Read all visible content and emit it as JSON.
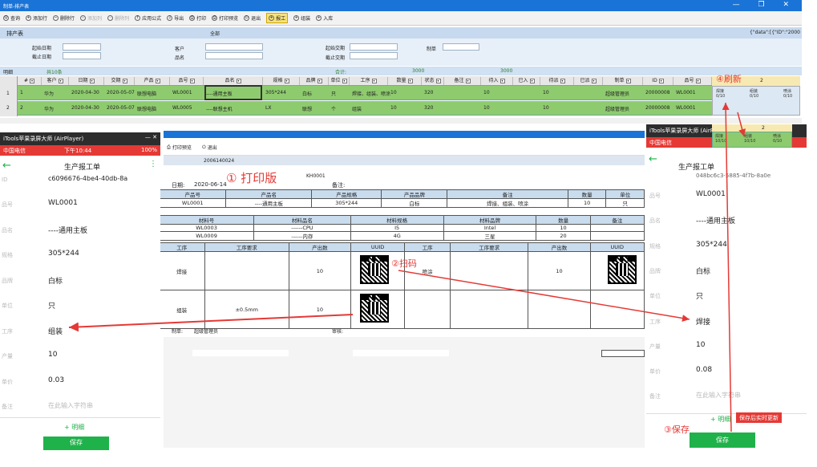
{
  "window": {
    "title": "制单-排产表",
    "controls": "—  ❐  ✕"
  },
  "toolbar": [
    {
      "icon": "search-icon",
      "glyph": "Q",
      "label": "查询",
      "enabled": true
    },
    {
      "icon": "add-row-icon",
      "glyph": "+",
      "label": "添加行",
      "enabled": true
    },
    {
      "icon": "delete-row-icon",
      "glyph": "−",
      "label": "删除行",
      "enabled": true
    },
    {
      "icon": "add-col-icon",
      "glyph": "+",
      "label": "添加列",
      "enabled": false
    },
    {
      "icon": "delete-col-icon",
      "glyph": "−",
      "label": "删除列",
      "enabled": false
    },
    {
      "icon": "formula-icon",
      "glyph": "f",
      "label": "应用公式",
      "enabled": true
    },
    {
      "icon": "export-icon",
      "glyph": "⇩",
      "label": "导出",
      "enabled": true
    },
    {
      "icon": "print-icon",
      "glyph": "⎙",
      "label": "打印",
      "enabled": true
    },
    {
      "icon": "print-preview-icon",
      "glyph": "⎙",
      "label": "打印预览",
      "enabled": true
    },
    {
      "icon": "exit-icon",
      "glyph": "⏻",
      "label": "退出",
      "enabled": true
    },
    {
      "icon": "report-icon",
      "glyph": "+",
      "label": "报工",
      "enabled": true,
      "highlight": true
    },
    {
      "icon": "assemble-icon",
      "glyph": "+",
      "label": "组装",
      "enabled": true
    },
    {
      "icon": "stock-in-icon",
      "glyph": "+",
      "label": "入库",
      "enabled": true
    }
  ],
  "section": {
    "title": "排产表",
    "scope": "全部",
    "right": "{\"data\":[{\"ID\":\"2000"
  },
  "form": {
    "start_date": "起始日期",
    "end_date": "截止日期",
    "customer": "客户",
    "product_name": "品名",
    "delivery_start": "起始交期",
    "delivery_end": "截止交期",
    "maker": "制单"
  },
  "summary": {
    "tab": "明细",
    "count": "共10条",
    "total": "合计:",
    "qty_sum": "3000",
    "qty_sum2": "3000"
  },
  "grid": {
    "columns": [
      "#",
      "客户",
      "日期",
      "交期",
      "产品",
      "品号",
      "品名",
      "规格",
      "品牌",
      "单位",
      "工序",
      "数量",
      "状态",
      "备注",
      "待入",
      "已入",
      "待派",
      "已派",
      "制单",
      "ID",
      "品号"
    ],
    "rows": [
      [
        "1",
        "华为",
        "2020-04-30",
        "2020-05-07",
        "联想电脑",
        "WL0001",
        "----通用主板",
        "305*244",
        "白标",
        "只",
        "焊接、组装、喷涂",
        "10",
        "320",
        "",
        "10",
        "",
        "10",
        "",
        "超级管理员",
        "20000008",
        "WL0001"
      ],
      [
        "2",
        "华为",
        "2020-04-30",
        "2020-05-07",
        "联想电脑",
        "WL0005",
        "----联想主机",
        "LX",
        "联想",
        "个",
        "组装",
        "10",
        "320",
        "",
        "10",
        "",
        "10",
        "",
        "超级管理员",
        "20000008",
        "WL0001"
      ]
    ],
    "right_header": "2",
    "right_cells": [
      [
        "焊接",
        "0/10"
      ],
      [
        "组装",
        "0/10"
      ],
      [
        "喷涂",
        "0/10"
      ]
    ]
  },
  "phone_left": {
    "title": "iTools苹果录屏大师 (AirPlayer)",
    "carrier": "中国电信",
    "time": "下午10:44",
    "battery": "100%",
    "header": "生产报工单",
    "id_label": "ID",
    "id_value": "c6096676-4be4-40db-8a",
    "fields": [
      {
        "label": "品号",
        "value": "WL0001"
      },
      {
        "label": "品名",
        "value": "----通用主板"
      },
      {
        "label": "规格",
        "value": "305*244"
      },
      {
        "label": "品牌",
        "value": "白标"
      },
      {
        "label": "单位",
        "value": "只"
      },
      {
        "label": "工序",
        "value": "组装"
      },
      {
        "label": "产量",
        "value": "10"
      },
      {
        "label": "单价",
        "value": "0.03"
      },
      {
        "label": "备注",
        "value": "在此输入字符串"
      }
    ],
    "detail_btn": "+ 明细",
    "save": "保存"
  },
  "phone_right": {
    "title": "iTools苹果录屏大师 (AirPlayer)",
    "carrier": "中国电信",
    "header": "生产报工单",
    "id_value": "048bc6c3-5885-4f7b-8a0e",
    "fields": [
      {
        "label": "品号",
        "value": "WL0001"
      },
      {
        "label": "品名",
        "value": "----通用主板"
      },
      {
        "label": "规格",
        "value": "305*244"
      },
      {
        "label": "品牌",
        "value": "白标"
      },
      {
        "label": "单位",
        "value": "只"
      },
      {
        "label": "工序",
        "value": "焊接"
      },
      {
        "label": "产量",
        "value": "10"
      },
      {
        "label": "单价",
        "value": "0.08"
      },
      {
        "label": "备注",
        "value": "在此输入字符串"
      }
    ],
    "detail_btn": "+ 明细",
    "save": "保存",
    "popup_header": "2",
    "popup_cells": [
      [
        "焊接",
        "10/10"
      ],
      [
        "组装",
        "10/10"
      ],
      [
        "喷涂",
        "0/10"
      ]
    ]
  },
  "print": {
    "toolbar": [
      {
        "icon": "print-icon",
        "label": "打印预览"
      },
      {
        "icon": "exit-icon",
        "label": "退出"
      }
    ],
    "doc_no": "2006140024",
    "kh": "KH0001",
    "date_label": "日期:",
    "date": "2020-06-14",
    "remark_label": "备注:",
    "product_head": [
      "产品号",
      "产品名",
      "产品规格",
      "产品品牌",
      "备注",
      "数量",
      "单位"
    ],
    "product_row": [
      "WL0001",
      "----通用主板",
      "305*244",
      "白标",
      "焊接、组装、喷涂",
      "10",
      "只"
    ],
    "mat_head": [
      "材料号",
      "材料品名",
      "材料规格",
      "材料品牌",
      "数量",
      "备注"
    ],
    "mat_rows": [
      [
        "WL0003",
        "------CPU",
        "I5",
        "Intel",
        "10",
        ""
      ],
      [
        "WL0009",
        "------内存",
        "4G",
        "三星",
        "20",
        ""
      ]
    ],
    "proc_head": [
      "工序",
      "工序要求",
      "产出数",
      "UUID",
      "工序",
      "工序要求",
      "产出数",
      "UUID"
    ],
    "proc_rows": [
      [
        "焊接",
        "",
        "10",
        "",
        "喷涂",
        "",
        "10",
        ""
      ],
      [
        "组装",
        "±0.5mm",
        "10",
        "",
        "",
        "",
        "",
        ""
      ]
    ],
    "maker_label": "制单:",
    "maker": "超级管理员",
    "review_label": "审核:"
  },
  "annotations": {
    "a1": "① 打印版",
    "a2": "②扫码",
    "a3": "③保存",
    "a4": "④刷新",
    "a5": "保存后实时更新"
  },
  "colors": {
    "titlebar": "#1a73d6",
    "row_green": "#8ecb6e",
    "annotation": "#e53935",
    "save_green": "#1fb24a"
  }
}
